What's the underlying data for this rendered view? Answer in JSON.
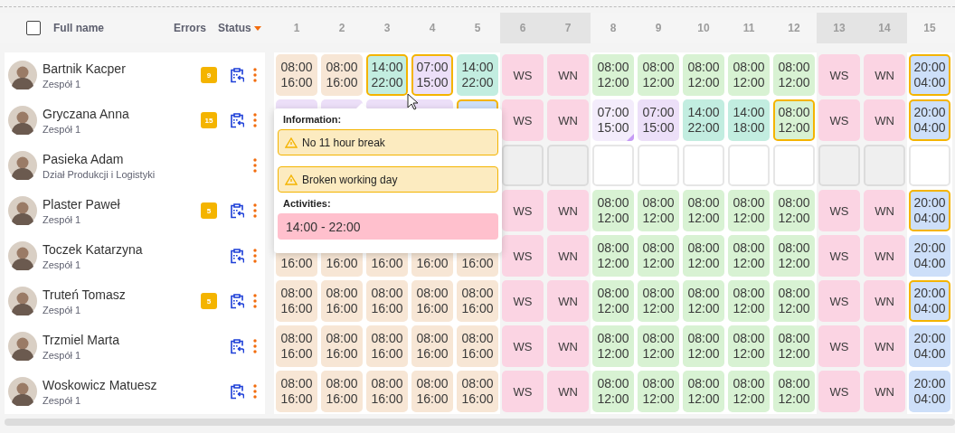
{
  "header": {
    "select_all": {
      "checked": false
    },
    "full_name": "Full name",
    "errors": "Errors",
    "status": "Status"
  },
  "days": [
    {
      "label": "1",
      "weekend": false
    },
    {
      "label": "2",
      "weekend": false
    },
    {
      "label": "3",
      "weekend": false
    },
    {
      "label": "4",
      "weekend": false
    },
    {
      "label": "5",
      "weekend": false
    },
    {
      "label": "6",
      "weekend": true
    },
    {
      "label": "7",
      "weekend": true
    },
    {
      "label": "8",
      "weekend": false
    },
    {
      "label": "9",
      "weekend": false
    },
    {
      "label": "10",
      "weekend": false
    },
    {
      "label": "11",
      "weekend": false
    },
    {
      "label": "12",
      "weekend": false
    },
    {
      "label": "13",
      "weekend": true
    },
    {
      "label": "14",
      "weekend": true
    },
    {
      "label": "15",
      "weekend": false
    }
  ],
  "employees": [
    {
      "name": "Bartnik Kacper",
      "team": "Zespół 1",
      "errors": "9",
      "status_icon": true,
      "cells": [
        {
          "kind": "shift",
          "color": "#f7e6d5",
          "start": "08:00",
          "end": "16:00",
          "highlighted": false,
          "flagged": false
        },
        {
          "kind": "shift",
          "color": "#f7e6d5",
          "start": "08:00",
          "end": "16:00",
          "highlighted": false,
          "flagged": false
        },
        {
          "kind": "shift",
          "color": "#c2ede0",
          "start": "14:00",
          "end": "22:00",
          "highlighted": true,
          "flagged": false
        },
        {
          "kind": "shift",
          "color": "#ecdff8",
          "start": "07:00",
          "end": "15:00",
          "highlighted": true,
          "flagged": false
        },
        {
          "kind": "shift",
          "color": "#c2ede0",
          "start": "14:00",
          "end": "22:00",
          "highlighted": false,
          "flagged": false
        },
        {
          "kind": "off",
          "color": "#fbd4e3",
          "label": "WS",
          "highlighted": false
        },
        {
          "kind": "off",
          "color": "#fbd4e3",
          "label": "WN",
          "highlighted": false
        },
        {
          "kind": "shift",
          "color": "#d8f2d3",
          "start": "08:00",
          "end": "12:00",
          "highlighted": false,
          "flagged": false
        },
        {
          "kind": "shift",
          "color": "#d8f2d3",
          "start": "08:00",
          "end": "12:00",
          "highlighted": false,
          "flagged": false
        },
        {
          "kind": "shift",
          "color": "#d8f2d3",
          "start": "08:00",
          "end": "12:00",
          "highlighted": false,
          "flagged": false
        },
        {
          "kind": "shift",
          "color": "#d8f2d3",
          "start": "08:00",
          "end": "12:00",
          "highlighted": false,
          "flagged": false
        },
        {
          "kind": "shift",
          "color": "#d8f2d3",
          "start": "08:00",
          "end": "12:00",
          "highlighted": false,
          "flagged": false
        },
        {
          "kind": "off",
          "color": "#fbd4e3",
          "label": "WS",
          "highlighted": false
        },
        {
          "kind": "off",
          "color": "#fbd4e3",
          "label": "WN",
          "highlighted": false
        },
        {
          "kind": "shift",
          "color": "#cddff9",
          "start": "20:00",
          "end": "04:00",
          "highlighted": true,
          "flagged": false
        }
      ]
    },
    {
      "name": "Gryczana Anna",
      "team": "Zespół 1",
      "errors": "15",
      "status_icon": true,
      "cells": [
        {
          "kind": "shift",
          "color": "#ecdff8",
          "highlighted": false
        },
        {
          "kind": "shift",
          "color": "#ecdff8",
          "highlighted": false
        },
        {
          "kind": "shift",
          "color": "#ecdff8",
          "highlighted": false
        },
        {
          "kind": "shift",
          "color": "#ecdff8",
          "highlighted": false
        },
        {
          "kind": "shift",
          "color": "#cddff9",
          "highlighted": true
        },
        {
          "kind": "off",
          "color": "#fbd4e3",
          "label": "WS",
          "highlighted": false
        },
        {
          "kind": "off",
          "color": "#fbd4e3",
          "label": "WN",
          "highlighted": false
        },
        {
          "kind": "shift",
          "color": "#f3ecfb",
          "start": "07:00",
          "end": "15:00",
          "highlighted": false,
          "flagged": true
        },
        {
          "kind": "shift",
          "color": "#ecdff8",
          "start": "07:00",
          "end": "15:00",
          "highlighted": false,
          "flagged": false
        },
        {
          "kind": "shift",
          "color": "#c2ede0",
          "start": "14:00",
          "end": "22:00",
          "highlighted": false,
          "flagged": false
        },
        {
          "kind": "shift",
          "color": "#c2ede0",
          "start": "14:00",
          "end": "18:00",
          "highlighted": false,
          "flagged": false
        },
        {
          "kind": "shift",
          "color": "#d8f2d3",
          "start": "08:00",
          "end": "12:00",
          "highlighted": true,
          "flagged": false
        },
        {
          "kind": "off",
          "color": "#fbd4e3",
          "label": "WS",
          "highlighted": false
        },
        {
          "kind": "off",
          "color": "#fbd4e3",
          "label": "WN",
          "highlighted": false
        },
        {
          "kind": "shift",
          "color": "#cddff9",
          "start": "20:00",
          "end": "04:00",
          "highlighted": true,
          "flagged": false
        }
      ]
    },
    {
      "name": "Pasieka Adam",
      "team": "Dział Produkcji i Logistyki",
      "status_icon": false,
      "cells": [
        {
          "kind": "covered"
        },
        {
          "kind": "covered"
        },
        {
          "kind": "covered"
        },
        {
          "kind": "covered"
        },
        {
          "kind": "covered"
        },
        {
          "kind": "empty"
        },
        {
          "kind": "empty"
        },
        {
          "kind": "empty"
        },
        {
          "kind": "empty"
        },
        {
          "kind": "empty"
        },
        {
          "kind": "empty"
        },
        {
          "kind": "empty"
        },
        {
          "kind": "empty"
        },
        {
          "kind": "empty"
        },
        {
          "kind": "empty"
        }
      ]
    },
    {
      "name": "Plaster Paweł",
      "team": "Zespół 1",
      "errors": "5",
      "status_icon": true,
      "cells": [
        {
          "kind": "covered"
        },
        {
          "kind": "covered"
        },
        {
          "kind": "covered"
        },
        {
          "kind": "covered"
        },
        {
          "kind": "covered"
        },
        {
          "kind": "off",
          "color": "#fbd4e3",
          "label": "WS",
          "highlighted": false
        },
        {
          "kind": "off",
          "color": "#fbd4e3",
          "label": "WN",
          "highlighted": false
        },
        {
          "kind": "shift",
          "color": "#d8f2d3",
          "start": "08:00",
          "end": "12:00",
          "highlighted": false,
          "flagged": false
        },
        {
          "kind": "shift",
          "color": "#d8f2d3",
          "start": "08:00",
          "end": "12:00",
          "highlighted": false,
          "flagged": false
        },
        {
          "kind": "shift",
          "color": "#d8f2d3",
          "start": "08:00",
          "end": "12:00",
          "highlighted": false,
          "flagged": false
        },
        {
          "kind": "shift",
          "color": "#d8f2d3",
          "start": "08:00",
          "end": "12:00",
          "highlighted": false,
          "flagged": false
        },
        {
          "kind": "shift",
          "color": "#d8f2d3",
          "start": "08:00",
          "end": "12:00",
          "highlighted": false,
          "flagged": false
        },
        {
          "kind": "off",
          "color": "#fbd4e3",
          "label": "WS",
          "highlighted": false
        },
        {
          "kind": "off",
          "color": "#fbd4e3",
          "label": "WN",
          "highlighted": false
        },
        {
          "kind": "shift",
          "color": "#cddff9",
          "start": "20:00",
          "end": "04:00",
          "highlighted": true,
          "flagged": false
        }
      ]
    },
    {
      "name": "Toczek Katarzyna",
      "team": "Zespół 1",
      "status_icon": true,
      "cells": [
        {
          "kind": "shift",
          "color": "#f7e6d5",
          "end": "16:00",
          "highlighted": false,
          "flagged": false
        },
        {
          "kind": "shift",
          "color": "#f7e6d5",
          "end": "16:00",
          "highlighted": false,
          "flagged": false
        },
        {
          "kind": "shift",
          "color": "#f7e6d5",
          "end": "16:00",
          "highlighted": false,
          "flagged": false
        },
        {
          "kind": "shift",
          "color": "#f7e6d5",
          "end": "16:00",
          "highlighted": false,
          "flagged": false
        },
        {
          "kind": "shift",
          "color": "#f7e6d5",
          "end": "16:00",
          "highlighted": false,
          "flagged": false
        },
        {
          "kind": "off",
          "color": "#fbd4e3",
          "label": "WS",
          "highlighted": false
        },
        {
          "kind": "off",
          "color": "#fbd4e3",
          "label": "WN",
          "highlighted": false
        },
        {
          "kind": "shift",
          "color": "#d8f2d3",
          "start": "08:00",
          "end": "12:00",
          "highlighted": false,
          "flagged": false
        },
        {
          "kind": "shift",
          "color": "#d8f2d3",
          "start": "08:00",
          "end": "12:00",
          "highlighted": false,
          "flagged": false
        },
        {
          "kind": "shift",
          "color": "#d8f2d3",
          "start": "08:00",
          "end": "12:00",
          "highlighted": false,
          "flagged": false
        },
        {
          "kind": "shift",
          "color": "#d8f2d3",
          "start": "08:00",
          "end": "12:00",
          "highlighted": false,
          "flagged": false
        },
        {
          "kind": "shift",
          "color": "#d8f2d3",
          "start": "08:00",
          "end": "12:00",
          "highlighted": false,
          "flagged": false
        },
        {
          "kind": "off",
          "color": "#fbd4e3",
          "label": "WS",
          "highlighted": false
        },
        {
          "kind": "off",
          "color": "#fbd4e3",
          "label": "WN",
          "highlighted": false
        },
        {
          "kind": "shift",
          "color": "#cddff9",
          "start": "20:00",
          "end": "04:00",
          "highlighted": false,
          "flagged": false
        }
      ]
    },
    {
      "name": "Truteń Tomasz",
      "team": "Zespół 1",
      "errors": "5",
      "status_icon": true,
      "cells": [
        {
          "kind": "shift",
          "color": "#f7e6d5",
          "start": "08:00",
          "end": "16:00",
          "highlighted": false,
          "flagged": false
        },
        {
          "kind": "shift",
          "color": "#f7e6d5",
          "start": "08:00",
          "end": "16:00",
          "highlighted": false,
          "flagged": false
        },
        {
          "kind": "shift",
          "color": "#f7e6d5",
          "start": "08:00",
          "end": "16:00",
          "highlighted": false,
          "flagged": false
        },
        {
          "kind": "shift",
          "color": "#f7e6d5",
          "start": "08:00",
          "end": "16:00",
          "highlighted": false,
          "flagged": false
        },
        {
          "kind": "shift",
          "color": "#f7e6d5",
          "start": "08:00",
          "end": "16:00",
          "highlighted": false,
          "flagged": false
        },
        {
          "kind": "off",
          "color": "#fbd4e3",
          "label": "WS",
          "highlighted": false
        },
        {
          "kind": "off",
          "color": "#fbd4e3",
          "label": "WN",
          "highlighted": false
        },
        {
          "kind": "shift",
          "color": "#d8f2d3",
          "start": "08:00",
          "end": "12:00",
          "highlighted": false,
          "flagged": false
        },
        {
          "kind": "shift",
          "color": "#d8f2d3",
          "start": "08:00",
          "end": "12:00",
          "highlighted": false,
          "flagged": false
        },
        {
          "kind": "shift",
          "color": "#d8f2d3",
          "start": "08:00",
          "end": "12:00",
          "highlighted": false,
          "flagged": false
        },
        {
          "kind": "shift",
          "color": "#d8f2d3",
          "start": "08:00",
          "end": "12:00",
          "highlighted": false,
          "flagged": false
        },
        {
          "kind": "shift",
          "color": "#d8f2d3",
          "start": "08:00",
          "end": "12:00",
          "highlighted": false,
          "flagged": false
        },
        {
          "kind": "off",
          "color": "#fbd4e3",
          "label": "WS",
          "highlighted": false
        },
        {
          "kind": "off",
          "color": "#fbd4e3",
          "label": "WN",
          "highlighted": false
        },
        {
          "kind": "shift",
          "color": "#cddff9",
          "start": "20:00",
          "end": "04:00",
          "highlighted": true,
          "flagged": false
        }
      ]
    },
    {
      "name": "Trzmiel Marta",
      "team": "Zespół 1",
      "status_icon": true,
      "cells": [
        {
          "kind": "shift",
          "color": "#f7e6d5",
          "start": "08:00",
          "end": "16:00",
          "highlighted": false,
          "flagged": false
        },
        {
          "kind": "shift",
          "color": "#f7e6d5",
          "start": "08:00",
          "end": "16:00",
          "highlighted": false,
          "flagged": false
        },
        {
          "kind": "shift",
          "color": "#f7e6d5",
          "start": "08:00",
          "end": "16:00",
          "highlighted": false,
          "flagged": false
        },
        {
          "kind": "shift",
          "color": "#f7e6d5",
          "start": "08:00",
          "end": "16:00",
          "highlighted": false,
          "flagged": false
        },
        {
          "kind": "shift",
          "color": "#f7e6d5",
          "start": "08:00",
          "end": "16:00",
          "highlighted": false,
          "flagged": false
        },
        {
          "kind": "off",
          "color": "#fbd4e3",
          "label": "WS",
          "highlighted": false
        },
        {
          "kind": "off",
          "color": "#fbd4e3",
          "label": "WN",
          "highlighted": false
        },
        {
          "kind": "shift",
          "color": "#d8f2d3",
          "start": "08:00",
          "end": "12:00",
          "highlighted": false,
          "flagged": false
        },
        {
          "kind": "shift",
          "color": "#d8f2d3",
          "start": "08:00",
          "end": "12:00",
          "highlighted": false,
          "flagged": false
        },
        {
          "kind": "shift",
          "color": "#d8f2d3",
          "start": "08:00",
          "end": "12:00",
          "highlighted": false,
          "flagged": false
        },
        {
          "kind": "shift",
          "color": "#d8f2d3",
          "start": "08:00",
          "end": "12:00",
          "highlighted": false,
          "flagged": false
        },
        {
          "kind": "shift",
          "color": "#d8f2d3",
          "start": "08:00",
          "end": "12:00",
          "highlighted": false,
          "flagged": false
        },
        {
          "kind": "off",
          "color": "#fbd4e3",
          "label": "WS",
          "highlighted": false
        },
        {
          "kind": "off",
          "color": "#fbd4e3",
          "label": "WN",
          "highlighted": false
        },
        {
          "kind": "shift",
          "color": "#cddff9",
          "start": "20:00",
          "end": "04:00",
          "highlighted": false,
          "flagged": false
        }
      ]
    },
    {
      "name": "Woskowicz Matuesz",
      "team": "Zespół 1",
      "status_icon": true,
      "cells": [
        {
          "kind": "shift",
          "color": "#f7e6d5",
          "start": "08:00",
          "end": "16:00",
          "highlighted": false,
          "flagged": false
        },
        {
          "kind": "shift",
          "color": "#f7e6d5",
          "start": "08:00",
          "end": "16:00",
          "highlighted": false,
          "flagged": false
        },
        {
          "kind": "shift",
          "color": "#f7e6d5",
          "start": "08:00",
          "end": "16:00",
          "highlighted": false,
          "flagged": false
        },
        {
          "kind": "shift",
          "color": "#f7e6d5",
          "start": "08:00",
          "end": "16:00",
          "highlighted": false,
          "flagged": false
        },
        {
          "kind": "shift",
          "color": "#f7e6d5",
          "start": "08:00",
          "end": "16:00",
          "highlighted": false,
          "flagged": false
        },
        {
          "kind": "off",
          "color": "#fbd4e3",
          "label": "WS",
          "highlighted": false
        },
        {
          "kind": "off",
          "color": "#fbd4e3",
          "label": "WN",
          "highlighted": false
        },
        {
          "kind": "shift",
          "color": "#d8f2d3",
          "start": "08:00",
          "end": "12:00",
          "highlighted": false,
          "flagged": false
        },
        {
          "kind": "shift",
          "color": "#d8f2d3",
          "start": "08:00",
          "end": "12:00",
          "highlighted": false,
          "flagged": false
        },
        {
          "kind": "shift",
          "color": "#d8f2d3",
          "start": "08:00",
          "end": "12:00",
          "highlighted": false,
          "flagged": false
        },
        {
          "kind": "shift",
          "color": "#d8f2d3",
          "start": "08:00",
          "end": "12:00",
          "highlighted": false,
          "flagged": false
        },
        {
          "kind": "shift",
          "color": "#d8f2d3",
          "start": "08:00",
          "end": "12:00",
          "highlighted": false,
          "flagged": false
        },
        {
          "kind": "off",
          "color": "#fbd4e3",
          "label": "WS",
          "highlighted": false
        },
        {
          "kind": "off",
          "color": "#fbd4e3",
          "label": "WN",
          "highlighted": false
        },
        {
          "kind": "shift",
          "color": "#cddff9",
          "start": "20:00",
          "end": "04:00",
          "highlighted": false,
          "flagged": false
        }
      ]
    }
  ],
  "popup": {
    "information_title": "Information:",
    "warnings": [
      "No 11 hour break",
      "Broken working day"
    ],
    "activities_title": "Activities:",
    "activities": [
      "14:00 - 22:00"
    ]
  }
}
